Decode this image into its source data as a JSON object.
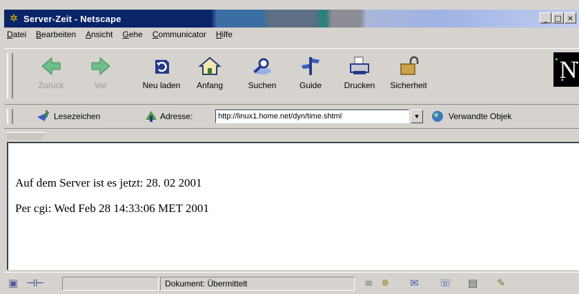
{
  "window": {
    "title": "Server-Zeit - Netscape"
  },
  "menu": [
    "Datei",
    "Bearbeiten",
    "Ansicht",
    "Gehe",
    "Communicator",
    "Hilfe"
  ],
  "toolbar": {
    "buttons": [
      {
        "label": "Zurück",
        "icon": "back-arrow-icon",
        "enabled": false
      },
      {
        "label": "Vor",
        "icon": "forward-arrow-icon",
        "enabled": false
      },
      {
        "label": "Neu laden",
        "icon": "reload-icon",
        "enabled": true
      },
      {
        "label": "Anfang",
        "icon": "home-icon",
        "enabled": true
      },
      {
        "label": "Suchen",
        "icon": "search-icon",
        "enabled": true
      },
      {
        "label": "Guide",
        "icon": "guide-icon",
        "enabled": true
      },
      {
        "label": "Drucken",
        "icon": "print-icon",
        "enabled": true
      },
      {
        "label": "Sicherheit",
        "icon": "security-lock-icon",
        "enabled": true
      }
    ],
    "logo": "N"
  },
  "location": {
    "bookmarks_label": "Lesezeichen",
    "address_label": "Adresse:",
    "url": "http://linux1.home.net/dyn/time.shtml",
    "related_label": "Verwandte Objek"
  },
  "content": {
    "line1": "Auf dem Server ist es jetzt: 28. 02 2001",
    "line2": "Per cgi: Wed Feb 28 14:33:06 MET 2001"
  },
  "status": {
    "text": "Dokument: Übermittelt"
  },
  "colors": {
    "titlebar": "#0a246a",
    "chrome": "#d6d3ce",
    "disabled_text": "#9a9a9a"
  }
}
